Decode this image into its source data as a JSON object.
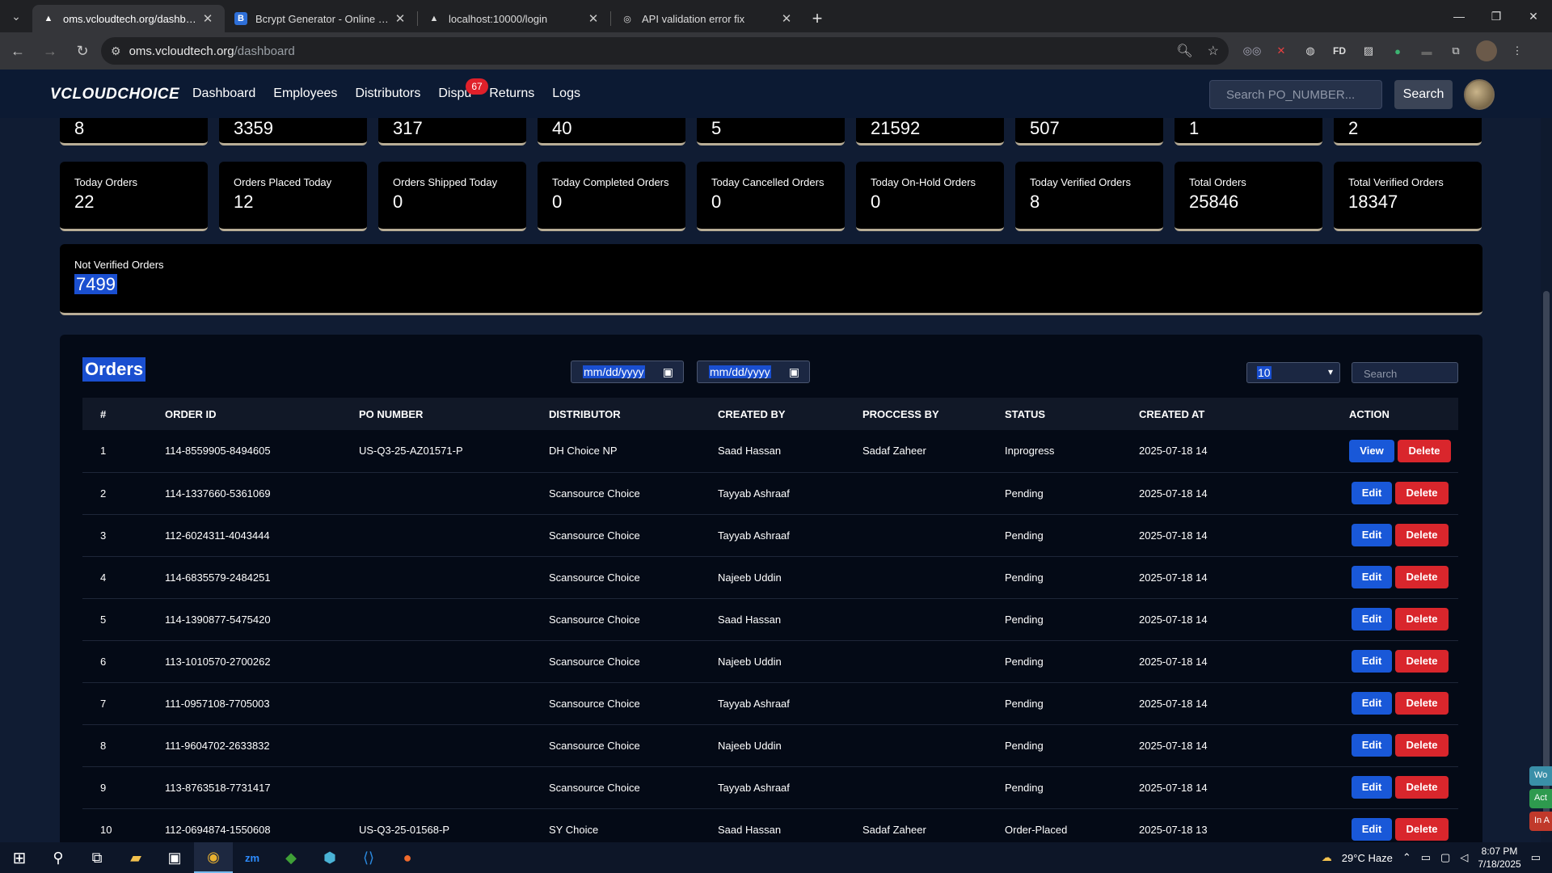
{
  "browser": {
    "tabs": [
      {
        "title": "oms.vcloudtech.org/dashboard",
        "active": true,
        "icon": "triangle-favicon"
      },
      {
        "title": "Bcrypt Generator - Online Hash",
        "active": false,
        "icon": "b-favicon"
      },
      {
        "title": "localhost:10000/login",
        "active": false,
        "icon": "triangle-favicon"
      },
      {
        "title": "API validation error fix",
        "active": false,
        "icon": "openai-favicon"
      }
    ],
    "url_host": "oms.vcloudtech.org",
    "url_path": "/dashboard"
  },
  "app": {
    "logo": "CLOUDCHOICE",
    "nav": [
      "Dashboard",
      "Employees",
      "Distributors",
      "Dispu",
      "Returns",
      "Logs"
    ],
    "disputes_badge": "67",
    "search_placeholder": "Search PO_NUMBER...",
    "search_button": "Search"
  },
  "top_cards": [
    "8",
    "3359",
    "317",
    "40",
    "5",
    "21592",
    "507",
    "1",
    "2"
  ],
  "stat_cards": [
    {
      "label": "Today Orders",
      "value": "22"
    },
    {
      "label": "Orders Placed Today",
      "value": "12"
    },
    {
      "label": "Orders Shipped Today",
      "value": "0"
    },
    {
      "label": "Today Completed Orders",
      "value": "0"
    },
    {
      "label": "Today Cancelled Orders",
      "value": "0"
    },
    {
      "label": "Today On-Hold Orders",
      "value": "0"
    },
    {
      "label": "Today Verified Orders",
      "value": "8"
    },
    {
      "label": "Total Orders",
      "value": "25846"
    },
    {
      "label": "Total Verified Orders",
      "value": "18347"
    }
  ],
  "not_verified": {
    "label": "Not Verified Orders",
    "value": "7499"
  },
  "orders": {
    "title": "Orders",
    "date_placeholder": "mm/dd/yyyy",
    "page_size": "10",
    "search_placeholder": "Search",
    "columns": [
      "#",
      "ORDER ID",
      "PO NUMBER",
      "DISTRIBUTOR",
      "CREATED BY",
      "PROCCESS BY",
      "STATUS",
      "CREATED AT",
      "ACTION"
    ],
    "rows": [
      {
        "n": "1",
        "order_id": "114-8559905-8494605",
        "po": "US-Q3-25-AZ01571-P",
        "distributor": "DH Choice NP",
        "created_by": "Saad Hassan",
        "process_by": "Sadaf Zaheer",
        "status": "Inprogress",
        "created_at": "2025-07-18 14",
        "primary": "View"
      },
      {
        "n": "2",
        "order_id": "114-1337660-5361069",
        "po": "",
        "distributor": "Scansource Choice",
        "created_by": "Tayyab Ashraaf",
        "process_by": "",
        "status": "Pending",
        "created_at": "2025-07-18 14",
        "primary": "Edit"
      },
      {
        "n": "3",
        "order_id": "112-6024311-4043444",
        "po": "",
        "distributor": "Scansource Choice",
        "created_by": "Tayyab Ashraaf",
        "process_by": "",
        "status": "Pending",
        "created_at": "2025-07-18 14",
        "primary": "Edit"
      },
      {
        "n": "4",
        "order_id": "114-6835579-2484251",
        "po": "",
        "distributor": "Scansource Choice",
        "created_by": "Najeeb Uddin",
        "process_by": "",
        "status": "Pending",
        "created_at": "2025-07-18 14",
        "primary": "Edit"
      },
      {
        "n": "5",
        "order_id": "114-1390877-5475420",
        "po": "",
        "distributor": "Scansource Choice",
        "created_by": "Saad Hassan",
        "process_by": "",
        "status": "Pending",
        "created_at": "2025-07-18 14",
        "primary": "Edit"
      },
      {
        "n": "6",
        "order_id": "113-1010570-2700262",
        "po": "",
        "distributor": "Scansource Choice",
        "created_by": "Najeeb Uddin",
        "process_by": "",
        "status": "Pending",
        "created_at": "2025-07-18 14",
        "primary": "Edit"
      },
      {
        "n": "7",
        "order_id": "111-0957108-7705003",
        "po": "",
        "distributor": "Scansource Choice",
        "created_by": "Tayyab Ashraaf",
        "process_by": "",
        "status": "Pending",
        "created_at": "2025-07-18 14",
        "primary": "Edit"
      },
      {
        "n": "8",
        "order_id": "111-9604702-2633832",
        "po": "",
        "distributor": "Scansource Choice",
        "created_by": "Najeeb Uddin",
        "process_by": "",
        "status": "Pending",
        "created_at": "2025-07-18 14",
        "primary": "Edit"
      },
      {
        "n": "9",
        "order_id": "113-8763518-7731417",
        "po": "",
        "distributor": "Scansource Choice",
        "created_by": "Tayyab Ashraaf",
        "process_by": "",
        "status": "Pending",
        "created_at": "2025-07-18 14",
        "primary": "Edit"
      },
      {
        "n": "10",
        "order_id": "112-0694874-1550608",
        "po": "US-Q3-25-01568-P",
        "distributor": "SY Choice",
        "created_by": "Saad Hassan",
        "process_by": "Sadaf Zaheer",
        "status": "Order-Placed",
        "created_at": "2025-07-18 13",
        "primary": "Edit"
      }
    ],
    "delete_label": "Delete"
  },
  "side_tags": [
    {
      "text": "Wo",
      "color": "#3a8fa8"
    },
    {
      "text": "Act",
      "color": "#2e9a4e"
    },
    {
      "text": "In A",
      "color": "#c0392b"
    }
  ],
  "taskbar": {
    "weather": "29°C  Haze",
    "time": "8:07 PM",
    "date": "7/18/2025"
  }
}
